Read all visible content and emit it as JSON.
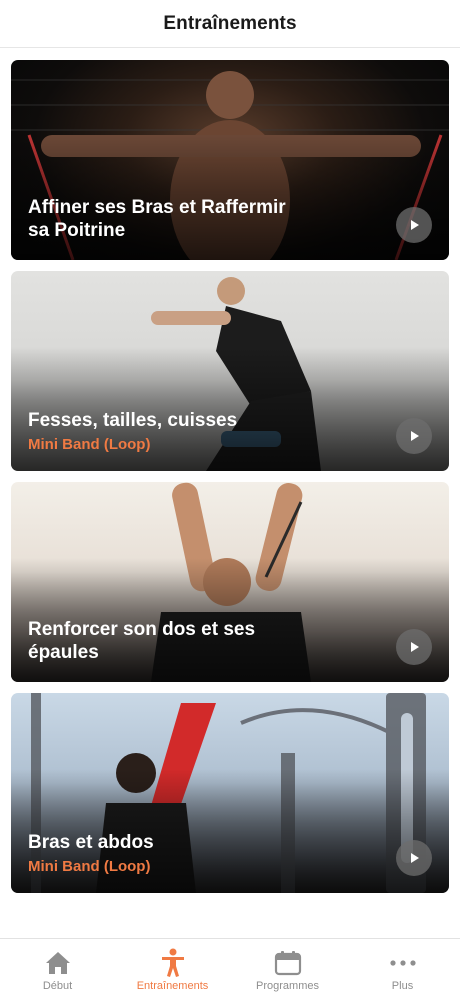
{
  "header": {
    "title": "Entraînements"
  },
  "workouts": [
    {
      "title_line1": "Affiner ses Bras et Raffermir",
      "title_line2": "sa Poitrine",
      "subtitle": ""
    },
    {
      "title_line1": "Fesses, tailles, cuisses",
      "title_line2": "",
      "subtitle": "Mini Band (Loop)"
    },
    {
      "title_line1": "Renforcer son dos et ses",
      "title_line2": "épaules",
      "subtitle": ""
    },
    {
      "title_line1": "Bras et abdos",
      "title_line2": "",
      "subtitle": "Mini Band (Loop)"
    }
  ],
  "tabs": [
    {
      "label": "Début",
      "icon": "home-icon",
      "active": false
    },
    {
      "label": "Entraînements",
      "icon": "person-workout-icon",
      "active": true
    },
    {
      "label": "Programmes",
      "icon": "calendar-icon",
      "active": false
    },
    {
      "label": "Plus",
      "icon": "more-dots-icon",
      "active": false
    }
  ],
  "colors": {
    "accent": "#f07a43",
    "inactive": "#8e8e8e"
  }
}
